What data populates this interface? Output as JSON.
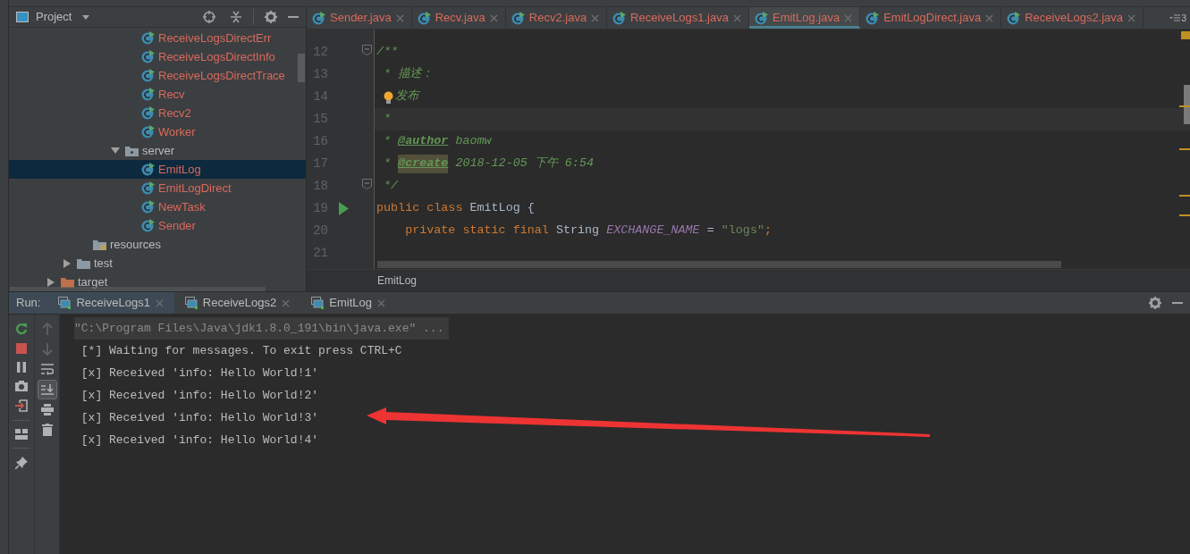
{
  "project_panel": {
    "title": "Project",
    "tree": [
      {
        "children": [
          {
            "children": [
              {
                "children": [
                  {
                    "children": [
                      {
                        "children": [
                          {
                            "label": "ReceiveLogsDirectErr",
                            "kind": "class",
                            "selected": false
                          },
                          {
                            "label": "ReceiveLogsDirectInfo",
                            "kind": "class",
                            "selected": false
                          },
                          {
                            "label": "ReceiveLogsDirectTrace",
                            "kind": "class",
                            "selected": false
                          },
                          {
                            "label": "Recv",
                            "kind": "class",
                            "selected": false
                          },
                          {
                            "label": "Recv2",
                            "kind": "class",
                            "selected": false
                          },
                          {
                            "label": "Worker",
                            "kind": "class",
                            "selected": false
                          }
                        ]
                      },
                      {
                        "label": "server",
                        "kind": "package",
                        "expanded": true,
                        "selected": false,
                        "children": [
                          {
                            "label": "EmitLog",
                            "kind": "class",
                            "selected": true
                          },
                          {
                            "label": "EmitLogDirect",
                            "kind": "class",
                            "selected": false
                          },
                          {
                            "label": "NewTask",
                            "kind": "class",
                            "selected": false
                          },
                          {
                            "label": "Sender",
                            "kind": "class",
                            "selected": false
                          }
                        ]
                      }
                    ]
                  }
                ]
              },
              {
                "label": "resources",
                "kind": "resources",
                "selected": false
              }
            ]
          },
          {
            "label": "test",
            "kind": "folder",
            "expanded": false,
            "selected": false
          }
        ]
      },
      {
        "label": "target",
        "kind": "excluded",
        "expanded": false,
        "selected": false
      }
    ]
  },
  "editor": {
    "tabs": [
      {
        "label": "Sender.java",
        "selected": false
      },
      {
        "label": "Recv.java",
        "selected": false
      },
      {
        "label": "Recv2.java",
        "selected": false
      },
      {
        "label": "ReceiveLogs1.java",
        "selected": false
      },
      {
        "label": "EmitLog.java",
        "selected": true
      },
      {
        "label": "EmitLogDirect.java",
        "selected": false
      },
      {
        "label": "ReceiveLogs2.java",
        "selected": false
      }
    ],
    "overflow_count": "3",
    "lines": [
      {
        "number": "12",
        "fold": true,
        "tokens": [
          {
            "kind": "comment",
            "text": "/**"
          }
        ]
      },
      {
        "number": "13",
        "tokens": [
          {
            "kind": "comment",
            "text": " * 描述："
          }
        ]
      },
      {
        "number": "14",
        "bulb": true,
        "tokens": [
          {
            "kind": "comment",
            "text": "发布"
          }
        ]
      },
      {
        "number": "15",
        "current": true,
        "tokens": [
          {
            "kind": "comment",
            "text": " *"
          }
        ]
      },
      {
        "number": "16",
        "tokens": [
          {
            "kind": "comment",
            "text": " * "
          },
          {
            "kind": "tag",
            "text": "@author"
          },
          {
            "kind": "comment",
            "text": " baomw"
          }
        ]
      },
      {
        "number": "17",
        "tokens": [
          {
            "kind": "comment",
            "text": " * "
          },
          {
            "kind": "tag-marked",
            "text": "@create"
          },
          {
            "kind": "comment",
            "text": " 2018-12-05 下午 6:54"
          }
        ]
      },
      {
        "number": "18",
        "fold": true,
        "tokens": [
          {
            "kind": "comment",
            "text": " */"
          }
        ]
      },
      {
        "number": "19",
        "run": true,
        "tokens": [
          {
            "kind": "keyword",
            "text": "public class"
          },
          {
            "kind": "plain",
            "text": " EmitLog {"
          }
        ]
      },
      {
        "number": "20",
        "tokens": [
          {
            "kind": "keyword",
            "text": "    private static final"
          },
          {
            "kind": "plain",
            "text": " String "
          },
          {
            "kind": "constant",
            "text": "EXCHANGE_NAME"
          },
          {
            "kind": "plain",
            "text": " = "
          },
          {
            "kind": "string",
            "text": "\"logs\""
          },
          {
            "kind": "keyword",
            "text": ";"
          }
        ]
      },
      {
        "number": "21"
      }
    ],
    "breadcrumb": "EmitLog"
  },
  "run_panel": {
    "label": "Run:",
    "tabs": [
      {
        "label": "ReceiveLogs1",
        "selected": true
      },
      {
        "label": "ReceiveLogs2",
        "selected": false
      },
      {
        "label": "EmitLog",
        "selected": false
      }
    ],
    "console": [
      {
        "kind": "command",
        "text": "\"C:\\Program Files\\Java\\jdk1.8.0_191\\bin\\java.exe\" ..."
      },
      {
        "kind": "output",
        "text": " [*] Waiting for messages. To exit press CTRL+C"
      },
      {
        "kind": "output",
        "text": " [x] Received 'info: Hello World!1'"
      },
      {
        "kind": "output",
        "text": " [x] Received 'info: Hello World!2'"
      },
      {
        "kind": "output",
        "text": " [x] Received 'info: Hello World!3'"
      },
      {
        "kind": "output",
        "text": " [x] Received 'info: Hello World!4'"
      }
    ]
  }
}
